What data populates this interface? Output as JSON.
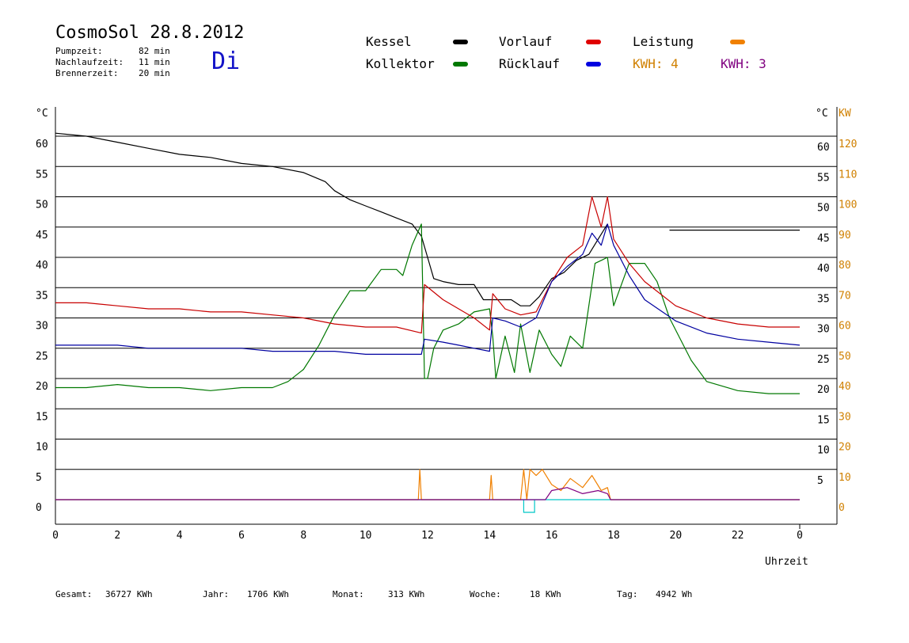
{
  "header": {
    "title": "CosmoSol 28.8.2012",
    "day": "Di",
    "info": [
      {
        "label": "Pumpzeit:",
        "value": "82 min"
      },
      {
        "label": "Nachlaufzeit:",
        "value": "11 min"
      },
      {
        "label": "Brennerzeit:",
        "value": "20 min"
      }
    ]
  },
  "legend": {
    "kessel": "Kessel",
    "kollektor": "Kollektor",
    "vorlauf": "Vorlauf",
    "ruecklauf": "Rücklauf",
    "leistung": "Leistung",
    "kwh_orange": "KWH: 4",
    "kwh_purple": "KWH: 3"
  },
  "footer": {
    "gesamt_label": "Gesamt:",
    "gesamt_value": "36727 KWh",
    "jahr_label": "Jahr:",
    "jahr_value": "1706 KWh",
    "monat_label": "Monat:",
    "monat_value": "313 KWh",
    "woche_label": "Woche:",
    "woche_value": "18 KWh",
    "tag_label": "Tag:",
    "tag_value": "4942 Wh"
  },
  "colors": {
    "kessel": "#000000",
    "kollektor": "#007800",
    "vorlauf": "#c80000",
    "ruecklauf": "#0000a0",
    "leistung": "#f08000",
    "kwh_purple": "#800080",
    "zero_line": "#00c8c8",
    "kw_axis": "#d08000",
    "day": "#1414c8"
  },
  "chart_data": {
    "type": "line",
    "xlabel": "Uhrzeit",
    "ylabel_left": "°C",
    "ylabel_right": "°C",
    "ylabel_kw": "KW",
    "xlim": [
      0,
      24
    ],
    "ylim": [
      0,
      60
    ],
    "ylim_kw": [
      0,
      120
    ],
    "grid": true,
    "x_ticks": [
      "0",
      "2",
      "4",
      "6",
      "8",
      "10",
      "12",
      "14",
      "16",
      "18",
      "20",
      "22",
      "0"
    ],
    "y_ticks": [
      0,
      5,
      10,
      15,
      20,
      25,
      30,
      35,
      40,
      45,
      50,
      55,
      60
    ],
    "y_ticks_right": [
      5,
      10,
      15,
      20,
      25,
      30,
      35,
      40,
      45,
      50,
      55,
      60
    ],
    "y_ticks_kw": [
      0,
      10,
      20,
      30,
      40,
      50,
      60,
      70,
      80,
      90,
      100,
      110,
      120
    ],
    "series": [
      {
        "name": "Kessel",
        "key": "kessel",
        "x": [
          0,
          1,
          2,
          3,
          4,
          5,
          6,
          7,
          8,
          8.7,
          9,
          9.5,
          10,
          10.5,
          11,
          11.5,
          11.8,
          12,
          12.2,
          12.5,
          13,
          13.5,
          13.8,
          14,
          14.3,
          14.7,
          15,
          15.3,
          15.6,
          16,
          16.4,
          16.8,
          17.2,
          17.5,
          17.8,
          18,
          18.1
        ],
        "y": [
          60.5,
          60,
          59,
          58,
          57,
          56.5,
          55.5,
          55,
          54,
          52.5,
          51,
          49.5,
          48.5,
          47.5,
          46.5,
          45.5,
          43.5,
          40,
          36.5,
          36,
          35.5,
          35.5,
          33,
          33,
          33,
          33,
          32,
          32,
          33.5,
          36.5,
          37.5,
          39.5,
          40.5,
          43,
          45.5,
          null,
          null
        ]
      },
      {
        "name": "Kessel (Brennerbetrieb)",
        "key": "kessel",
        "x": [
          19.8,
          21,
          22,
          23,
          24
        ],
        "y": [
          44.5,
          44.5,
          44.5,
          44.5,
          44.5
        ]
      },
      {
        "name": "Kollektor",
        "key": "kollektor",
        "x": [
          0,
          1,
          2,
          3,
          4,
          5,
          6,
          7,
          7.5,
          8,
          8.5,
          9,
          9.5,
          10,
          10.5,
          11,
          11.2,
          11.5,
          11.8,
          11.9,
          12,
          12.2,
          12.5,
          13,
          13.5,
          14,
          14.1,
          14.2,
          14.5,
          14.8,
          15,
          15.3,
          15.6,
          16,
          16.3,
          16.6,
          17,
          17.4,
          17.8,
          18,
          18.5,
          19,
          19.4,
          19.8,
          20.5,
          21,
          22,
          23,
          24
        ],
        "y": [
          18.5,
          18.5,
          19,
          18.5,
          18.5,
          18,
          18.5,
          18.5,
          19.5,
          21.5,
          25.5,
          30.5,
          34.5,
          34.5,
          38,
          38,
          37,
          42,
          45.5,
          20,
          20,
          25,
          28,
          29,
          31,
          31.5,
          27,
          20,
          27,
          21,
          29,
          21,
          28,
          24,
          22,
          27,
          25,
          39,
          40,
          32,
          39,
          39,
          36,
          30,
          23,
          19.5,
          18,
          17.5,
          17.5
        ]
      },
      {
        "name": "Vorlauf",
        "key": "vorlauf",
        "x": [
          0,
          1,
          2,
          3,
          4,
          5,
          6,
          7,
          8,
          9,
          10,
          11,
          11.8,
          11.9,
          12.5,
          13,
          13.5,
          14,
          14.1,
          14.5,
          15,
          15.5,
          16,
          16.5,
          17,
          17.3,
          17.6,
          17.8,
          18,
          18.5,
          19,
          20,
          21,
          22,
          23,
          24
        ],
        "y": [
          32.5,
          32.5,
          32,
          31.5,
          31.5,
          31,
          31,
          30.5,
          30,
          29,
          28.5,
          28.5,
          27.5,
          35.5,
          33,
          31.5,
          30,
          28,
          34,
          31.5,
          30.5,
          31,
          36,
          40,
          42,
          50,
          45,
          50,
          43,
          39,
          36,
          32,
          30,
          29,
          28.5,
          28.5
        ]
      },
      {
        "name": "Rücklauf",
        "key": "ruecklauf",
        "x": [
          0,
          1,
          2,
          3,
          4,
          5,
          6,
          7,
          8,
          9,
          10,
          11,
          11.8,
          11.9,
          12.5,
          13,
          13.5,
          14,
          14.1,
          14.5,
          15,
          15.5,
          16,
          16.5,
          17,
          17.3,
          17.6,
          17.8,
          18,
          18.5,
          19,
          20,
          21,
          22,
          23,
          24
        ],
        "y": [
          25.5,
          25.5,
          25.5,
          25,
          25,
          25,
          25,
          24.5,
          24.5,
          24.5,
          24,
          24,
          24,
          26.5,
          26,
          25.5,
          25,
          24.5,
          30,
          29.5,
          28.5,
          30,
          36,
          38.5,
          40.5,
          44,
          42,
          45.5,
          42,
          37,
          33,
          29.5,
          27.5,
          26.5,
          26,
          25.5
        ]
      },
      {
        "name": "Leistung",
        "key": "leistung",
        "axis": "kw",
        "x": [
          0,
          11.7,
          11.75,
          11.8,
          11.85,
          14,
          14.05,
          14.1,
          14.15,
          15,
          15.1,
          15.2,
          15.3,
          15.5,
          15.7,
          16,
          16.3,
          16.6,
          17,
          17.3,
          17.6,
          17.8,
          17.9,
          24
        ],
        "y": [
          0,
          0,
          10,
          0,
          0,
          0,
          8,
          0,
          0,
          0,
          10,
          0,
          10,
          8,
          10,
          5,
          3,
          7,
          4,
          8,
          3,
          4,
          0,
          0
        ]
      },
      {
        "name": "KWH",
        "key": "kwh_purple",
        "axis": "kw",
        "x": [
          0,
          15.8,
          16,
          16.5,
          17,
          17.5,
          17.8,
          17.9,
          24
        ],
        "y": [
          0,
          0,
          3,
          4,
          2,
          3,
          2,
          0,
          0
        ]
      }
    ]
  }
}
